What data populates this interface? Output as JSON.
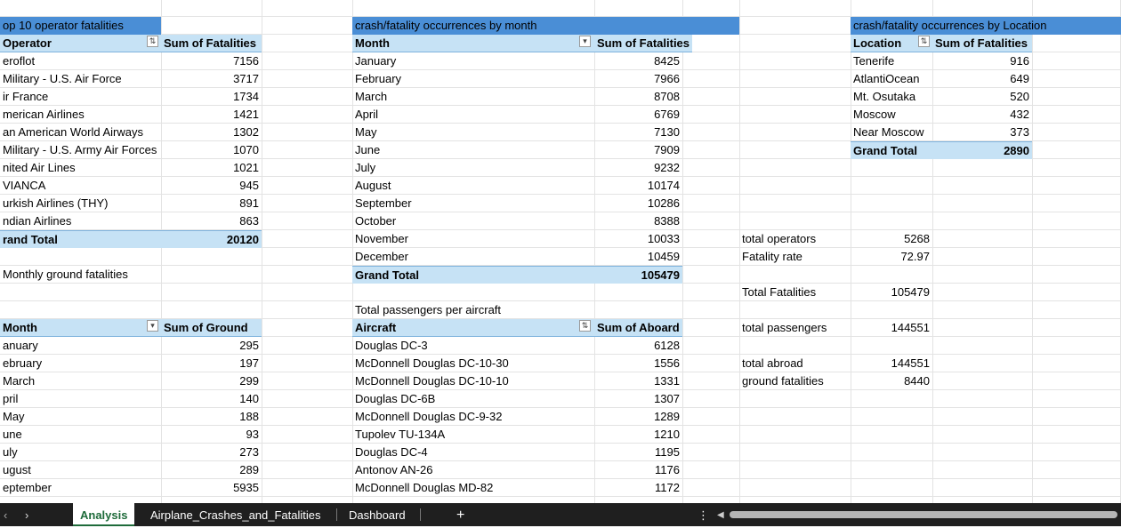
{
  "top_operators": {
    "title": "op 10 operator fatalities",
    "header_label": "Operator",
    "header_value": "Sum of Fatalities",
    "rows": [
      {
        "name": "eroflot",
        "value": "7156"
      },
      {
        "name": "Military - U.S. Air Force",
        "value": "3717"
      },
      {
        "name": "ir France",
        "value": "1734"
      },
      {
        "name": "merican Airlines",
        "value": "1421"
      },
      {
        "name": "an American World Airways",
        "value": "1302"
      },
      {
        "name": "Military - U.S. Army Air Forces",
        "value": "1070"
      },
      {
        "name": "nited Air Lines",
        "value": "1021"
      },
      {
        "name": "VIANCA",
        "value": "945"
      },
      {
        "name": "urkish Airlines (THY)",
        "value": "891"
      },
      {
        "name": "ndian Airlines",
        "value": "863"
      }
    ],
    "total_label": "rand Total",
    "total_value": "20120"
  },
  "monthly_ground": {
    "title": "Monthly ground fatalities",
    "header_label": "Month",
    "header_value": "Sum of Ground",
    "rows": [
      {
        "name": "anuary",
        "value": "295"
      },
      {
        "name": "ebruary",
        "value": "197"
      },
      {
        "name": "March",
        "value": "299"
      },
      {
        "name": "pril",
        "value": "140"
      },
      {
        "name": "May",
        "value": "188"
      },
      {
        "name": "une",
        "value": "93"
      },
      {
        "name": "uly",
        "value": "273"
      },
      {
        "name": "ugust",
        "value": "289"
      },
      {
        "name": "eptember",
        "value": "5935"
      }
    ]
  },
  "by_month": {
    "title": "crash/fatality occurrences by month",
    "header_label": "Month",
    "header_value": "Sum of Fatalities",
    "rows": [
      {
        "name": "January",
        "value": "8425"
      },
      {
        "name": "February",
        "value": "7966"
      },
      {
        "name": "March",
        "value": "8708"
      },
      {
        "name": "April",
        "value": "6769"
      },
      {
        "name": "May",
        "value": "7130"
      },
      {
        "name": "June",
        "value": "7909"
      },
      {
        "name": "July",
        "value": "9232"
      },
      {
        "name": "August",
        "value": "10174"
      },
      {
        "name": "September",
        "value": "10286"
      },
      {
        "name": "October",
        "value": "8388"
      },
      {
        "name": "November",
        "value": "10033"
      },
      {
        "name": "December",
        "value": "10459"
      }
    ],
    "total_label": "Grand Total",
    "total_value": "105479"
  },
  "passengers": {
    "title": "Total passengers per aircraft",
    "header_label": "Aircraft",
    "header_value": "Sum of Aboard",
    "rows": [
      {
        "name": "Douglas DC-3",
        "value": "6128"
      },
      {
        "name": "McDonnell Douglas DC-10-30",
        "value": "1556"
      },
      {
        "name": "McDonnell Douglas DC-10-10",
        "value": "1331"
      },
      {
        "name": "Douglas DC-6B",
        "value": "1307"
      },
      {
        "name": "McDonnell Douglas DC-9-32",
        "value": "1289"
      },
      {
        "name": "Tupolev TU-134A",
        "value": "1210"
      },
      {
        "name": "Douglas DC-4",
        "value": "1195"
      },
      {
        "name": "Antonov AN-26",
        "value": "1176"
      },
      {
        "name": "McDonnell Douglas MD-82",
        "value": "1172"
      }
    ]
  },
  "by_location": {
    "title": "crash/fatality occurrences by Location",
    "header_label": "Location",
    "header_value": "Sum of Fatalities",
    "rows": [
      {
        "name": "Tenerife",
        "value": "916"
      },
      {
        "name": "AtlantiOcean",
        "value": "649"
      },
      {
        "name": "Mt. Osutaka",
        "value": "520"
      },
      {
        "name": "Moscow",
        "value": "432"
      },
      {
        "name": "Near Moscow",
        "value": "373"
      }
    ],
    "total_label": "Grand Total",
    "total_value": "2890"
  },
  "stats": [
    {
      "label": "total operators",
      "value": "5268"
    },
    {
      "label": "Fatality rate",
      "value": "72.97"
    },
    {
      "label": "Total Fatalities",
      "value": "105479"
    },
    {
      "label": "total passengers",
      "value": "144551"
    },
    {
      "label": "total abroad",
      "value": "144551"
    },
    {
      "label": "ground fatalities",
      "value": "8440"
    }
  ],
  "sheet_tabs": {
    "active": "Analysis",
    "others": [
      "Airplane_Crashes_and_Fatalities",
      "Dashboard"
    ],
    "add_symbol": "+",
    "more_symbol": "⋮"
  },
  "colors": {
    "title_bar": "#4a8ed6",
    "header_fill": "#c6e2f5",
    "active_tab_text": "#1e6b3a"
  }
}
